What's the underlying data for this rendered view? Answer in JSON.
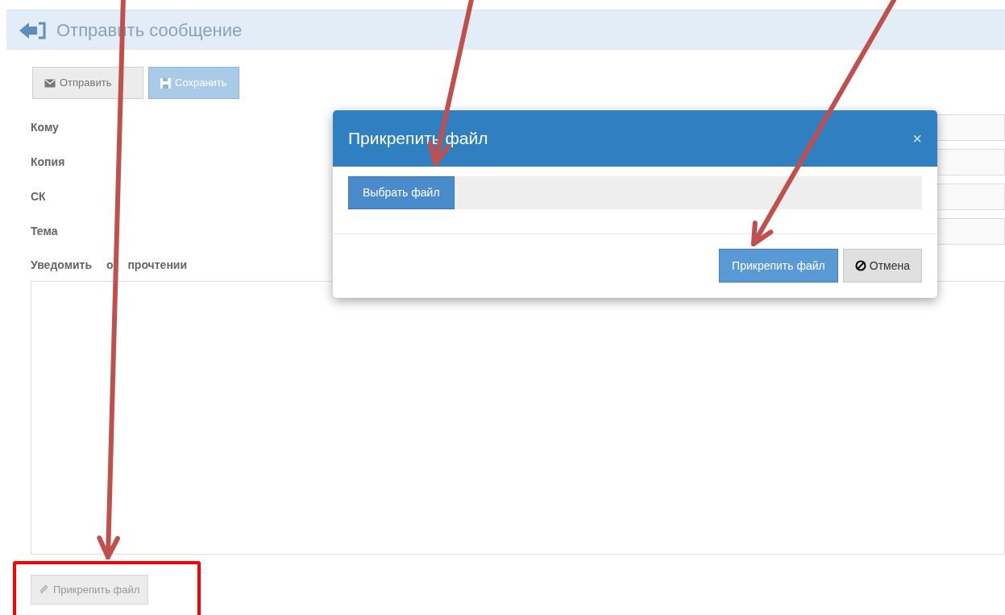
{
  "page": {
    "title": "Отправить сообщение"
  },
  "toolbar": [
    {
      "label": "Отправить",
      "kind": "send"
    },
    {
      "label": "Сохранить",
      "kind": "save"
    }
  ],
  "fields": [
    {
      "label": "Кому"
    },
    {
      "label": "Копия"
    },
    {
      "label": "СК"
    },
    {
      "label": "Тема"
    }
  ],
  "notify": {
    "label": "Уведомить о прочтении"
  },
  "attach_button": {
    "label": "Прикрепить файл",
    "highlighted": true
  },
  "dialog": {
    "title": "Прикрепить файл",
    "close": "×",
    "choose_button": "Выбрать файл",
    "buttons": [
      {
        "label": "Прикрепить файл",
        "kind": "primary"
      },
      {
        "label": "Отмена",
        "kind": "cancel"
      }
    ]
  }
}
